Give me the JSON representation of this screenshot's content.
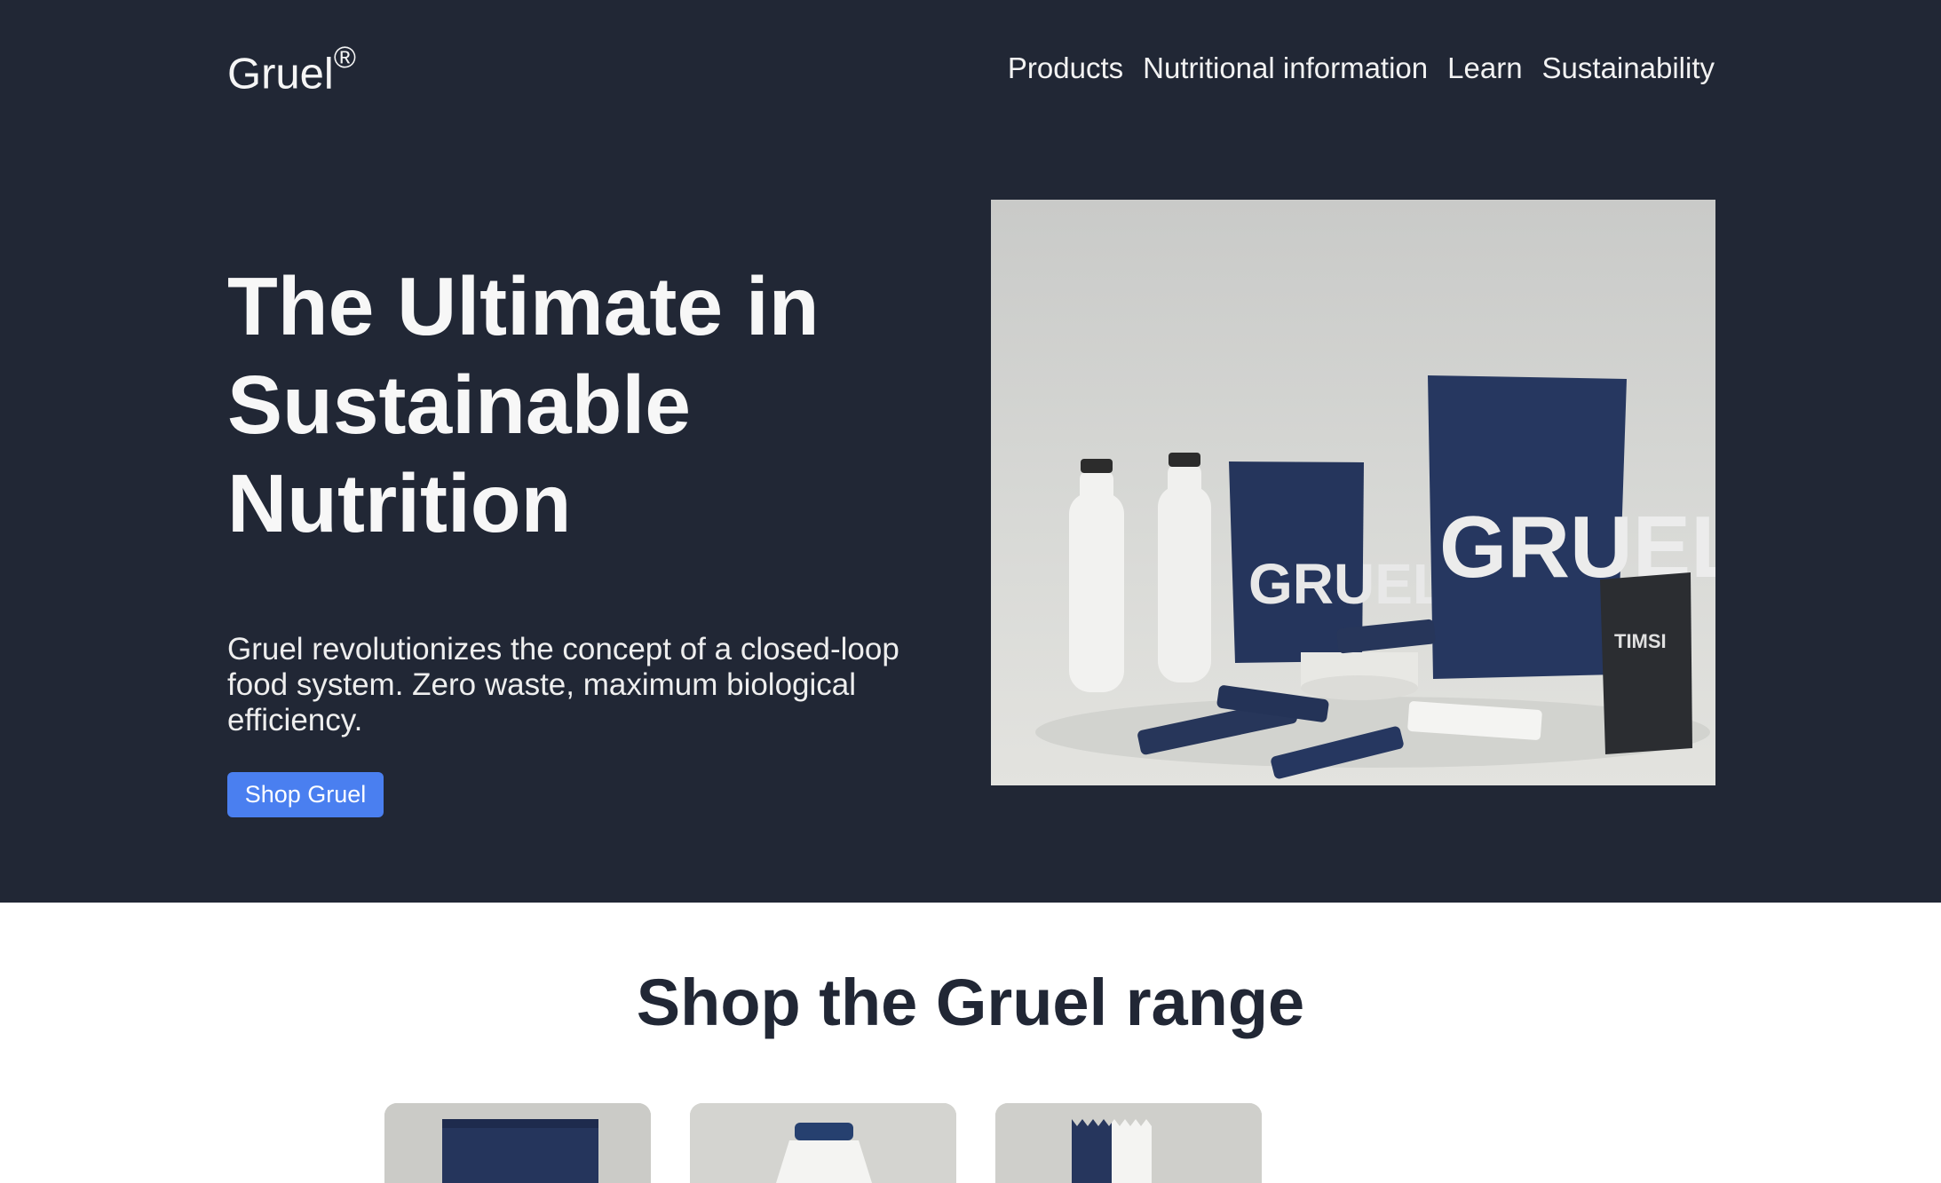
{
  "header": {
    "brand": "Gruel",
    "brand_mark": "®",
    "nav": [
      {
        "label": "Products"
      },
      {
        "label": "Nutritional information"
      },
      {
        "label": "Learn"
      },
      {
        "label": "Sustainability"
      }
    ]
  },
  "hero": {
    "headline": "The Ultimate in Sustainable Nutrition",
    "description": "Gruel revolutionizes the concept of a closed-loop food system. Zero waste, maximum biological efficiency.",
    "cta_label": "Shop Gruel",
    "image": {
      "subject": "product-photo",
      "package_labels": [
        "GRUEL",
        "GRUEL",
        "TIMSI"
      ]
    }
  },
  "range": {
    "title": "Shop the Gruel range",
    "cards": [
      {
        "image": "pouch-photo"
      },
      {
        "image": "bottle-photo"
      },
      {
        "image": "bar-photo"
      }
    ]
  },
  "colors": {
    "hero_bg": "#212735",
    "cta": "#4a7ff0",
    "heading": "#212735"
  }
}
